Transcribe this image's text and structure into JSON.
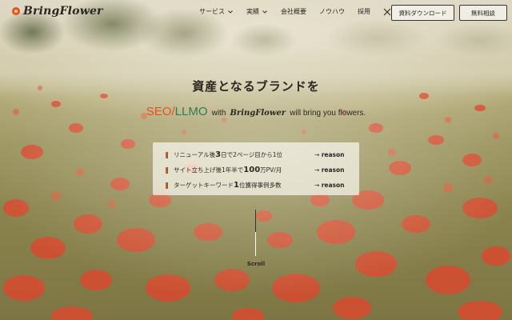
{
  "header": {
    "logo_text": "BringFlower",
    "nav": [
      {
        "label": "サービス",
        "has_dropdown": true
      },
      {
        "label": "実績",
        "has_dropdown": true
      },
      {
        "label": "会社概要",
        "has_dropdown": false
      },
      {
        "label": "ノウハウ",
        "has_dropdown": false
      },
      {
        "label": "採用",
        "has_dropdown": false
      }
    ],
    "social_icon": "x-icon",
    "download_button": "資料ダウンロード",
    "consult_button": "無料相談"
  },
  "hero": {
    "title": "資産となるブランドを",
    "subtitle": {
      "seo": "SEO",
      "slash": "/",
      "llmo": "LLMO",
      "with": "with",
      "brand": "BringFlower",
      "tail": "will bring you flowers."
    }
  },
  "results": [
    {
      "pre": "リニューアル後",
      "num": "3",
      "post": "日で2ページ目から1位",
      "link_arrow": "→",
      "link": "reason"
    },
    {
      "pre": "サイト立ち上げ後1年半で",
      "num": "100",
      "post": "万PV/月",
      "link_arrow": "→",
      "link": "reason"
    },
    {
      "pre": "ターゲットキーワード",
      "num": "1",
      "post": "位獲得事例多数",
      "link_arrow": "→",
      "link": "reason"
    }
  ],
  "scroll_label": "Scroll",
  "colors": {
    "accent_orange": "#e5521f",
    "accent_green": "#2e7d4f",
    "text_dark": "#2b2622"
  }
}
